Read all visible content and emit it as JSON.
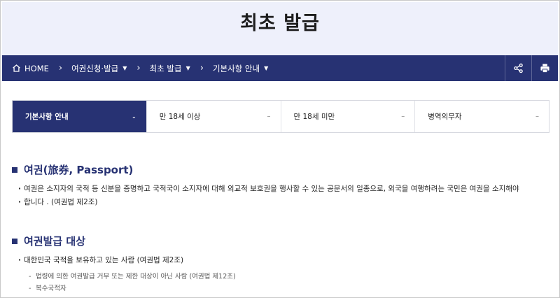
{
  "page": {
    "title": "최초 발급"
  },
  "breadcrumb": {
    "home": "HOME",
    "items": [
      {
        "label": "여권신청·발급",
        "has_dropdown": true
      },
      {
        "label": "최초 발급",
        "has_dropdown": true
      },
      {
        "label": "기본사항 안내",
        "has_dropdown": true
      }
    ]
  },
  "tabs": [
    {
      "label": "기본사항 안내",
      "active": true,
      "mark": "⌄"
    },
    {
      "label": "만 18세 이상",
      "active": false,
      "mark": "–"
    },
    {
      "label": "만 18세 미만",
      "active": false,
      "mark": "–"
    },
    {
      "label": "병역의무자",
      "active": false,
      "mark": "–"
    }
  ],
  "sections": {
    "passport": {
      "title": "여권(旅券, Passport)",
      "line1": "여권은 소지자의 국적 등 신분을 증명하고 국적국이 소지자에 대해 외교적 보호권을 행사할 수 있는 공문서의 일종으로, 외국을 여행하려는 국민은 여권을 소지해야",
      "line2": "합니다 . (여권법 제2조)"
    },
    "target": {
      "title": "여권발급 대상",
      "bullet": "대한민국 국적을 보유하고 있는 사람 (여권법 제2조)",
      "sub1": "법령에 의한 여권발급 거부 또는 제한 대상이 아닌 사람 (여권법 제12조)",
      "sub2": "복수국적자"
    }
  },
  "colors": {
    "navy": "#273273",
    "hero_bg": "#eef0fb"
  },
  "icons": {
    "home": "home-icon",
    "share": "share-icon",
    "print": "print-icon"
  }
}
